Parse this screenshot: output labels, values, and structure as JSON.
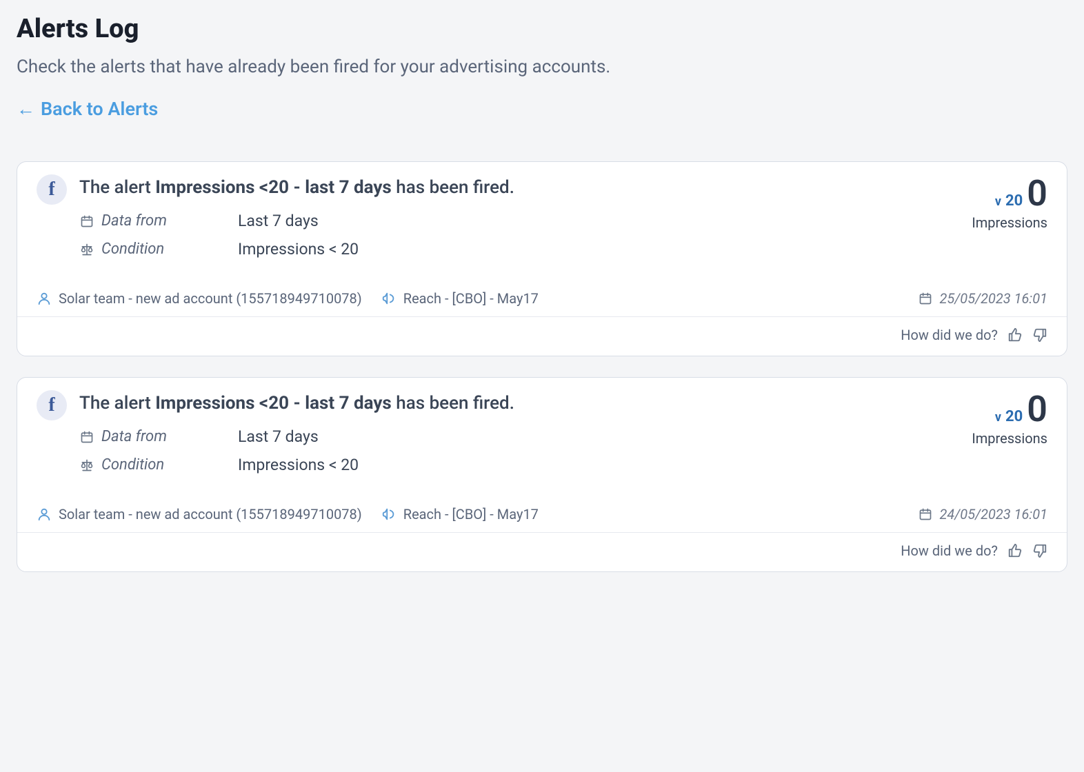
{
  "page": {
    "title": "Alerts Log",
    "subtitle": "Check the alerts that have already been fired for your advertising accounts.",
    "back_link": "Back to Alerts"
  },
  "labels": {
    "data_from": "Data from",
    "condition": "Condition",
    "feedback_prompt": "How did we do?"
  },
  "alerts": [
    {
      "title_prefix": "The alert",
      "title_bold": "Impressions <20 - last 7 days",
      "title_suffix": "has been fired.",
      "data_from": "Last 7 days",
      "condition": "Impressions < 20",
      "threshold": "20",
      "metric_value": "0",
      "metric_label": "Impressions",
      "account": "Solar team - new ad account (155718949710078)",
      "campaign": "Reach - [CBO] - May17",
      "timestamp": "25/05/2023 16:01"
    },
    {
      "title_prefix": "The alert",
      "title_bold": "Impressions <20 - last 7 days",
      "title_suffix": "has been fired.",
      "data_from": "Last 7 days",
      "condition": "Impressions < 20",
      "threshold": "20",
      "metric_value": "0",
      "metric_label": "Impressions",
      "account": "Solar team - new ad account (155718949710078)",
      "campaign": "Reach - [CBO] - May17",
      "timestamp": "24/05/2023 16:01"
    }
  ]
}
